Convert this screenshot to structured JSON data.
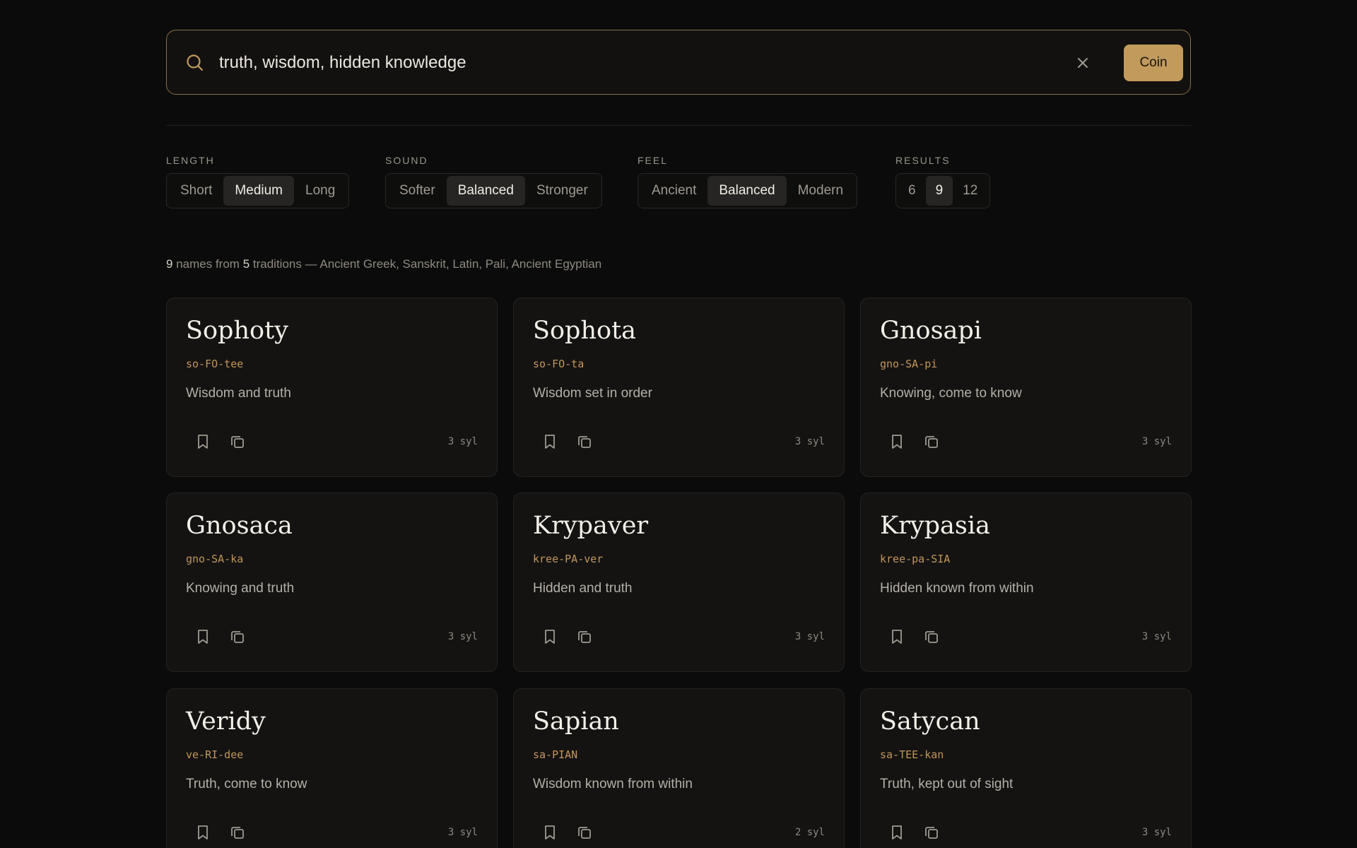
{
  "search": {
    "value": "truth, wisdom, hidden knowledge",
    "placeholder": "",
    "submit_label": "Coin"
  },
  "filters": {
    "length": {
      "label": "LENGTH",
      "options": [
        "Short",
        "Medium",
        "Long"
      ],
      "selected": "Medium"
    },
    "sound": {
      "label": "SOUND",
      "options": [
        "Softer",
        "Balanced",
        "Stronger"
      ],
      "selected": "Balanced"
    },
    "feel": {
      "label": "FEEL",
      "options": [
        "Ancient",
        "Balanced",
        "Modern"
      ],
      "selected": "Balanced"
    },
    "results": {
      "label": "RESULTS",
      "options": [
        "6",
        "9",
        "12"
      ],
      "selected": "9"
    }
  },
  "summary": {
    "count": "9",
    "names_from": "names from",
    "tradition_count": "5",
    "traditions_text": "traditions —",
    "traditions": "Ancient Greek, Sanskrit, Latin, Pali, Ancient Egyptian"
  },
  "cards": [
    {
      "name": "Sophoty",
      "pron": "so-FO-tee",
      "meaning": "Wisdom and truth",
      "syl": "3 syl"
    },
    {
      "name": "Sophota",
      "pron": "so-FO-ta",
      "meaning": "Wisdom set in order",
      "syl": "3 syl"
    },
    {
      "name": "Gnosapi",
      "pron": "gno-SA-pi",
      "meaning": "Knowing, come to know",
      "syl": "3 syl"
    },
    {
      "name": "Gnosaca",
      "pron": "gno-SA-ka",
      "meaning": "Knowing and truth",
      "syl": "3 syl"
    },
    {
      "name": "Krypaver",
      "pron": "kree-PA-ver",
      "meaning": "Hidden and truth",
      "syl": "3 syl"
    },
    {
      "name": "Krypasia",
      "pron": "kree-pa-SIA",
      "meaning": "Hidden known from within",
      "syl": "3 syl"
    },
    {
      "name": "Veridy",
      "pron": "ve-RI-dee",
      "meaning": "Truth, come to know",
      "syl": "3 syl"
    },
    {
      "name": "Sapian",
      "pron": "sa-PIAN",
      "meaning": "Wisdom known from within",
      "syl": "2 syl"
    },
    {
      "name": "Satycan",
      "pron": "sa-TEE-kan",
      "meaning": "Truth, kept out of sight",
      "syl": "3 syl"
    }
  ],
  "icons": {
    "search": "search-icon",
    "clear": "close-icon",
    "save": "bookmark-icon",
    "copy": "copy-icon"
  },
  "colors": {
    "accent": "#c29a5c",
    "background": "#0b0b0b",
    "card": "#141312"
  }
}
